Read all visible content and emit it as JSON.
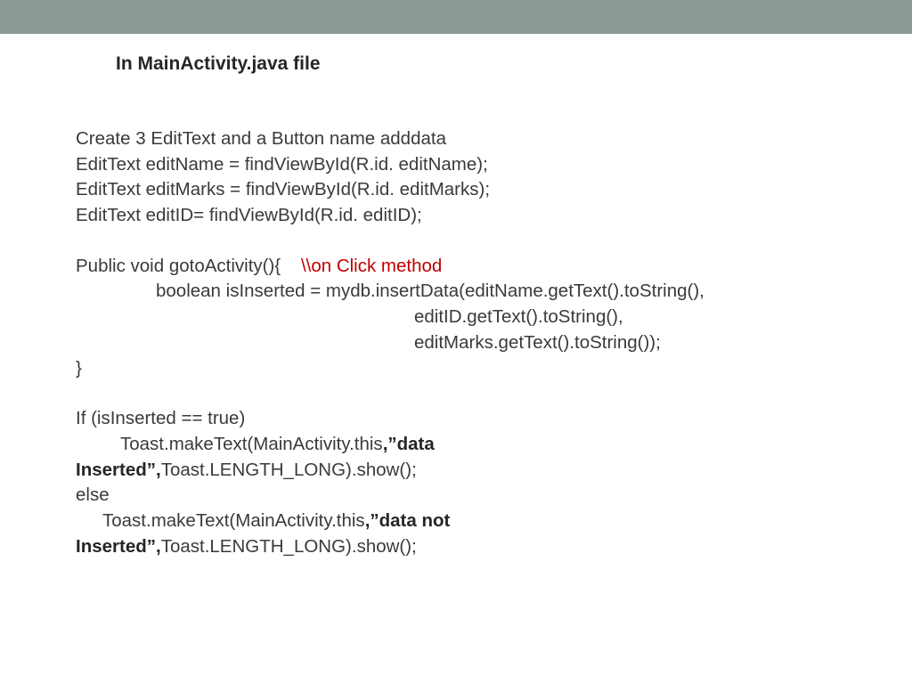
{
  "heading": "In MainActivity.java file",
  "lines": {
    "l1": "Create 3 EditText and a Button name adddata",
    "l2": "EditText editName = findViewById(R.id. editName);",
    "l3": "EditText editMarks = findViewById(R.id. editMarks);",
    "l4": "EditText editID= findViewById(R.id. editID);",
    "l5a": "Public void gotoActivity(){    ",
    "l5b": "\\\\on Click method",
    "l6": "boolean isInserted = mydb.insertData(editName.getText().toString(),",
    "l7": "editID.getText().toString(),",
    "l8": "editMarks.getText().toString());",
    "l9": "}",
    "l10": "If (isInserted == true)",
    "l11a": "Toast.makeText(MainActivity.this",
    "l11b": ",”data",
    "l12a": "Inserted”,",
    "l12b": "Toast.LENGTH_LONG).show();",
    "l13": "else",
    "l14a": "Toast.makeText(MainActivity.this",
    "l14b": ",”data not",
    "l15a": "Inserted”,",
    "l15b": "Toast.LENGTH_LONG).show();"
  }
}
